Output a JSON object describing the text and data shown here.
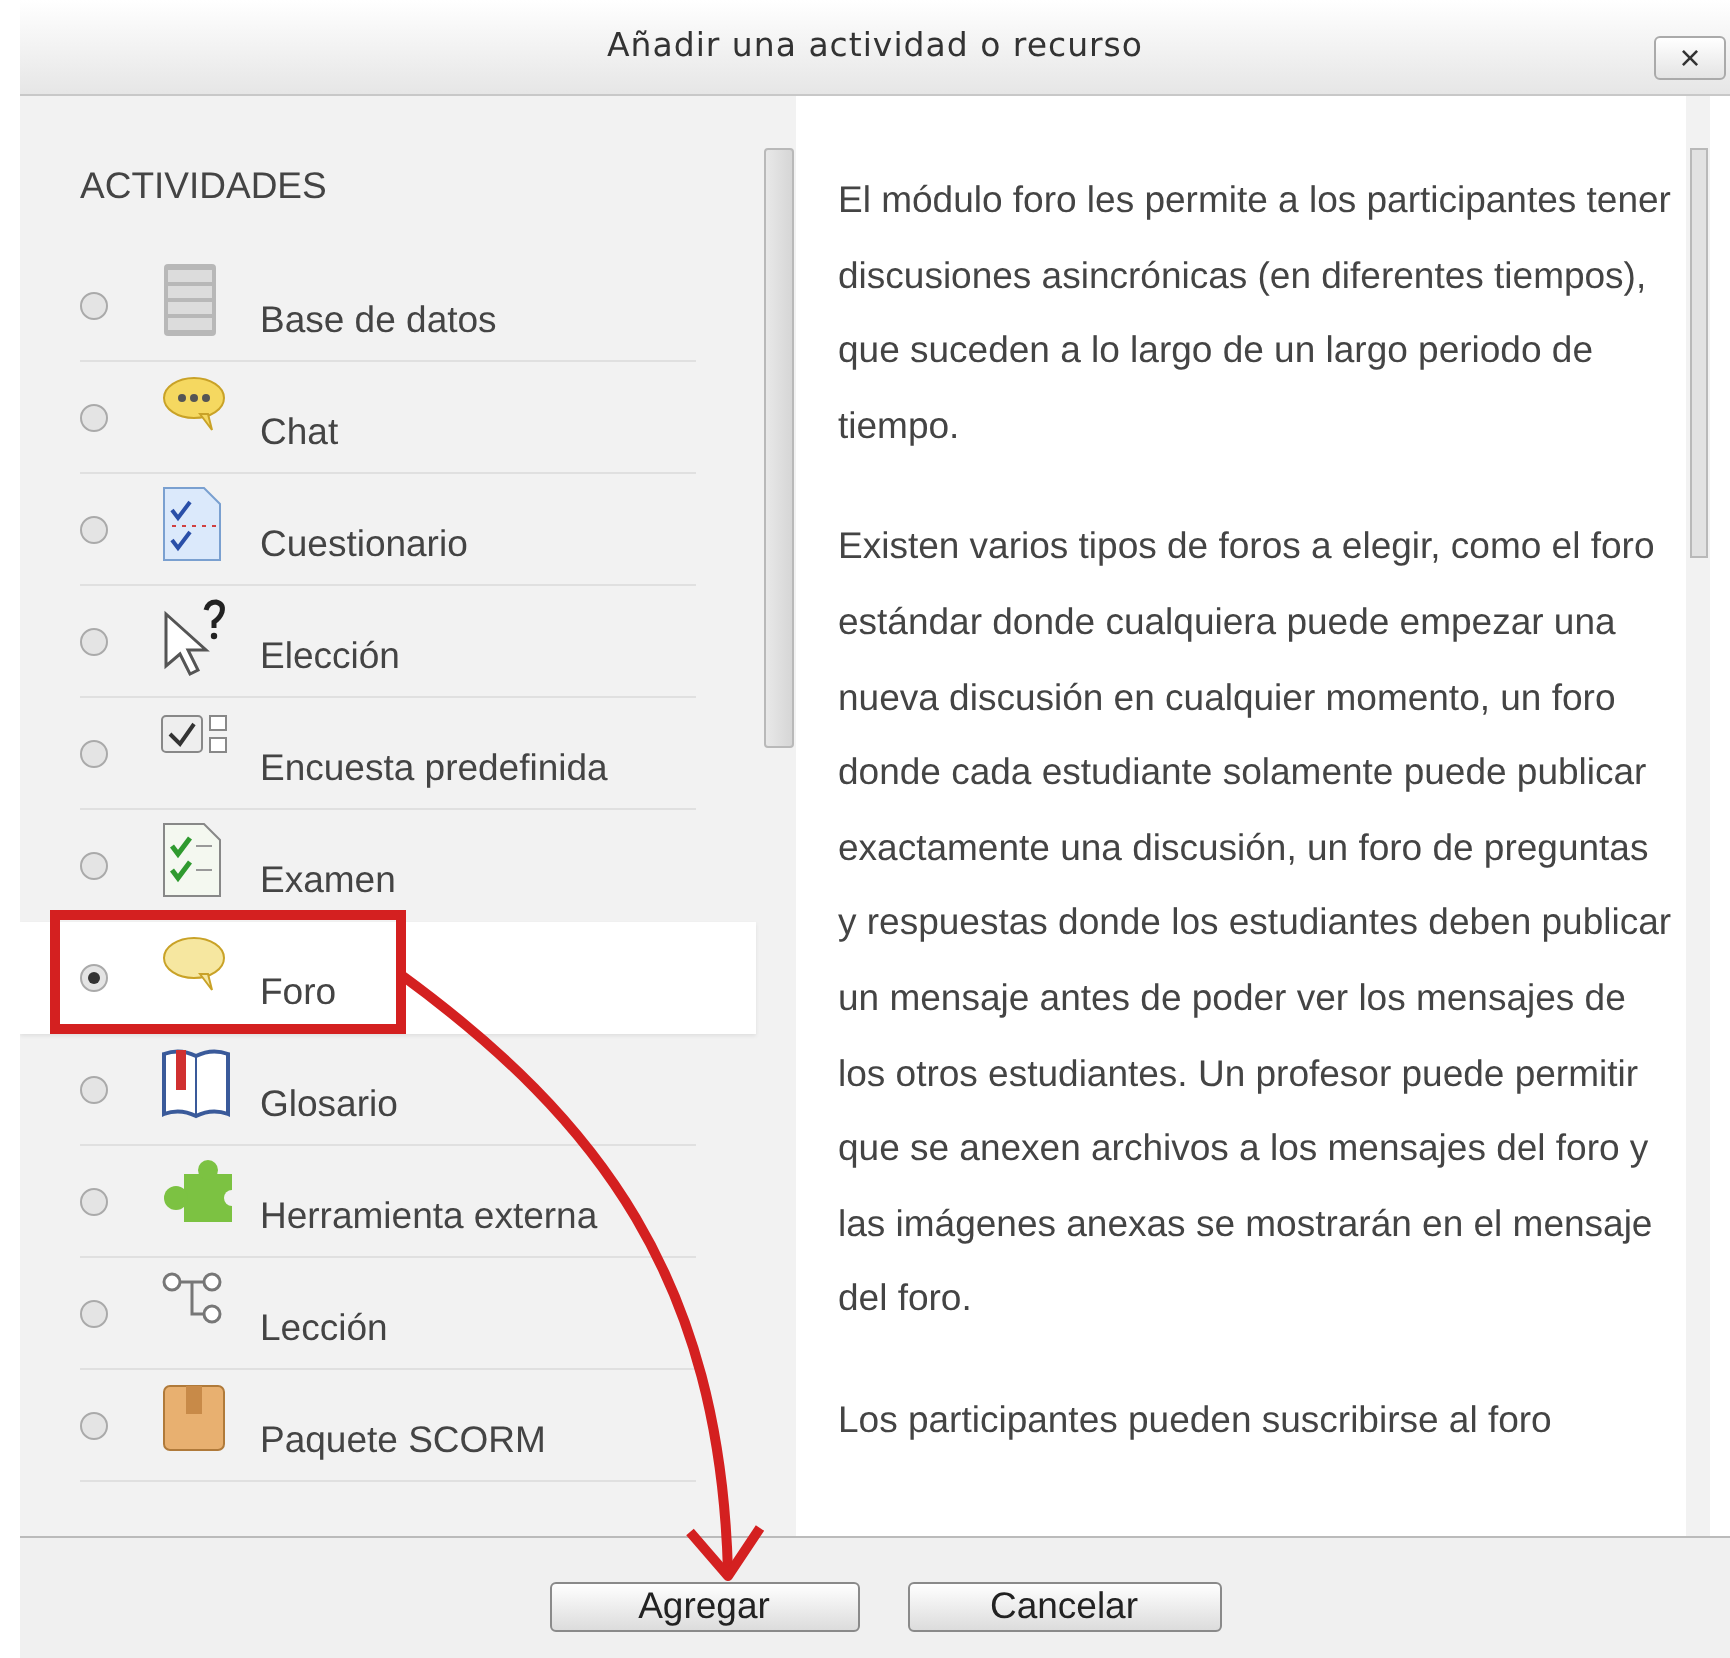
{
  "window": {
    "title": "Añadir una actividad o recurso",
    "close": "×"
  },
  "activities": {
    "heading": "ACTIVIDADES",
    "items": [
      {
        "label": "Base de datos",
        "selected": false
      },
      {
        "label": "Chat",
        "selected": false
      },
      {
        "label": "Cuestionario",
        "selected": false
      },
      {
        "label": "Elección",
        "selected": false
      },
      {
        "label": "Encuesta predefinida",
        "selected": false
      },
      {
        "label": "Examen",
        "selected": false
      },
      {
        "label": "Foro",
        "selected": true
      },
      {
        "label": "Glosario",
        "selected": false
      },
      {
        "label": "Herramienta externa",
        "selected": false
      },
      {
        "label": "Lección",
        "selected": false
      },
      {
        "label": "Paquete SCORM",
        "selected": false
      }
    ]
  },
  "description": [
    "El módulo foro les permite a los participantes tener discusiones asincrónicas (en diferentes tiempos), que suceden a lo largo de un largo periodo de tiempo.",
    "Existen varios tipos de foros a elegir, como el foro estándar donde cualquiera puede empezar una nueva discusión en cualquier momento, un foro donde cada estudiante solamente puede publicar exactamente una discusión, un foro de preguntas y respuestas donde los estudiantes deben publicar un mensaje antes de poder ver los mensajes de los otros estudiantes. Un profesor puede permitir que se anexen archivos a los mensajes del foro y las imágenes anexas se mostrarán en el mensaje del foro.",
    "Los participantes pueden suscribirse al foro"
  ],
  "buttons": [
    "Agregar",
    "Cancelar"
  ]
}
